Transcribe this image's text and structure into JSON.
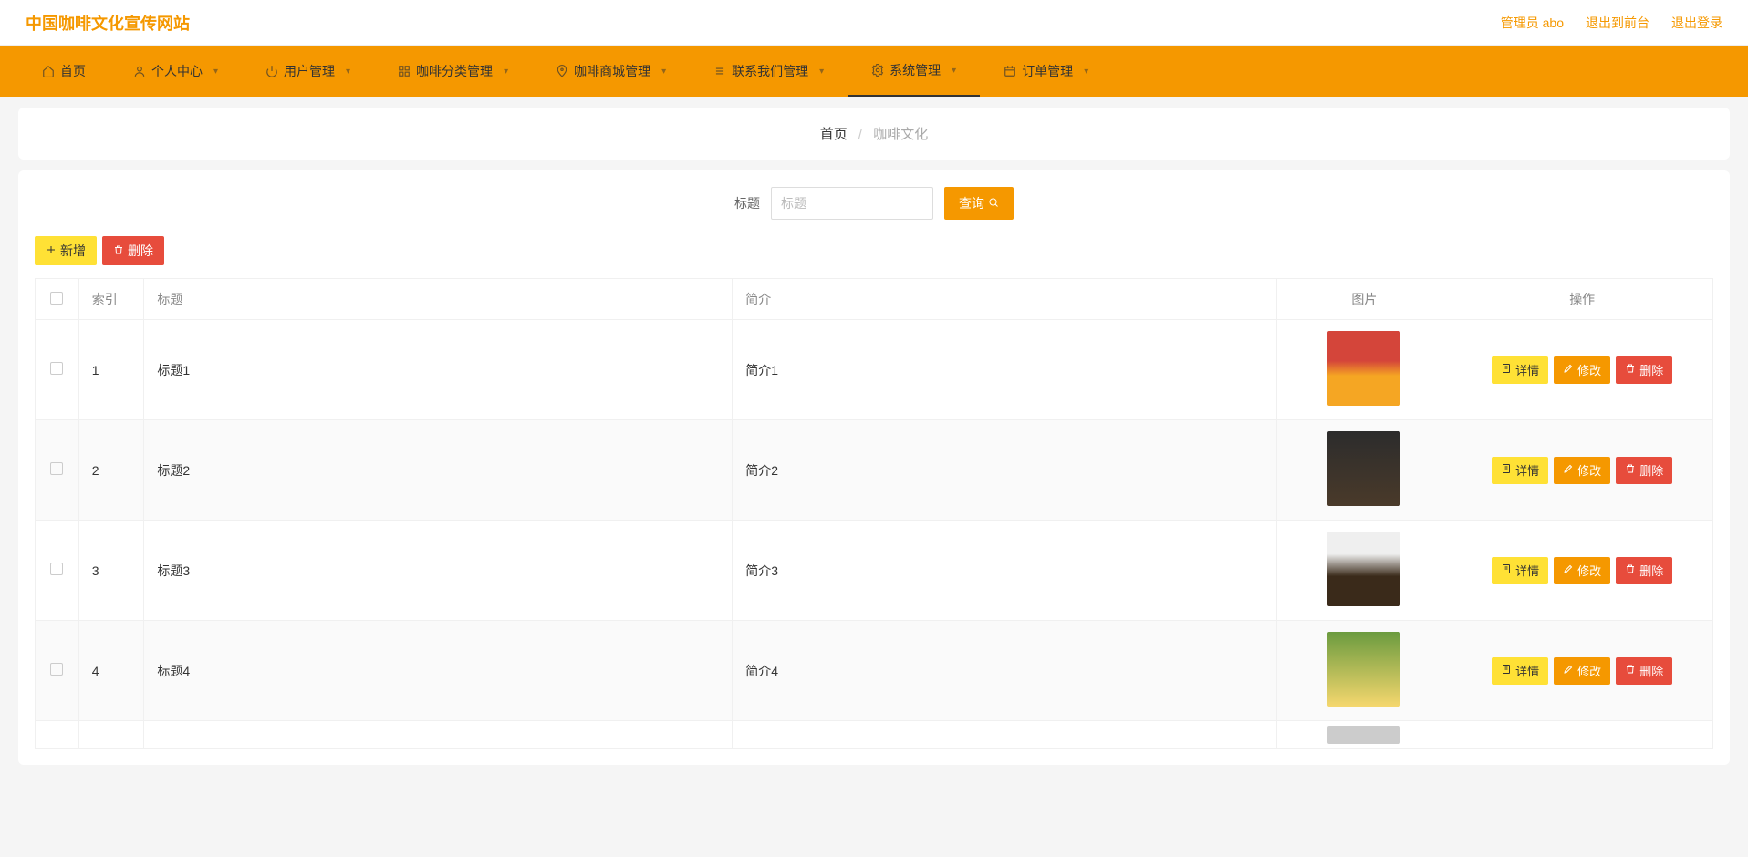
{
  "header": {
    "logo": "中国咖啡文化宣传网站",
    "admin_label": "管理员 abo",
    "front_label": "退出到前台",
    "logout_label": "退出登录"
  },
  "nav": {
    "items": [
      {
        "label": "首页",
        "icon": "home"
      },
      {
        "label": "个人中心",
        "icon": "user"
      },
      {
        "label": "用户管理",
        "icon": "power"
      },
      {
        "label": "咖啡分类管理",
        "icon": "grid"
      },
      {
        "label": "咖啡商城管理",
        "icon": "pin"
      },
      {
        "label": "联系我们管理",
        "icon": "list"
      },
      {
        "label": "系统管理",
        "icon": "gear"
      },
      {
        "label": "订单管理",
        "icon": "calendar"
      }
    ],
    "active_index": 6
  },
  "breadcrumb": {
    "home": "首页",
    "current": "咖啡文化"
  },
  "search": {
    "label": "标题",
    "placeholder": "标题",
    "button": "查询"
  },
  "toolbar": {
    "add_label": "新增",
    "delete_label": "删除"
  },
  "table": {
    "headers": {
      "index": "索引",
      "title": "标题",
      "intro": "简介",
      "image": "图片",
      "ops": "操作"
    },
    "row_buttons": {
      "detail": "详情",
      "edit": "修改",
      "delete": "删除"
    },
    "rows": [
      {
        "index": "1",
        "title": "标题1",
        "intro": "简介1"
      },
      {
        "index": "2",
        "title": "标题2",
        "intro": "简介2"
      },
      {
        "index": "3",
        "title": "标题3",
        "intro": "简介3"
      },
      {
        "index": "4",
        "title": "标题4",
        "intro": "简介4"
      }
    ]
  }
}
